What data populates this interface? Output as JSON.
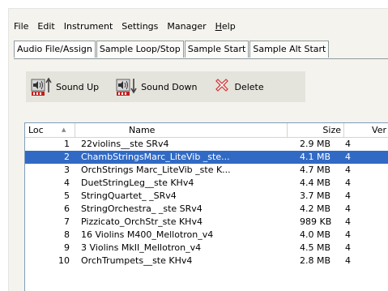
{
  "menubar": {
    "items": [
      {
        "label": "File"
      },
      {
        "label": "Edit"
      },
      {
        "label": "Instrument"
      },
      {
        "label": "Settings"
      },
      {
        "label": "Manager"
      },
      {
        "pre": "",
        "mnemonic": "H",
        "post": "elp"
      }
    ]
  },
  "tabs": [
    {
      "label": "Audio File/Assign",
      "active": true
    },
    {
      "label": "Sample Loop/Stop"
    },
    {
      "label": "Sample Start"
    },
    {
      "label": "Sample Alt Start"
    }
  ],
  "toolbar": {
    "sound_up": "Sound Up",
    "sound_down": "Sound Down",
    "delete": "Delete"
  },
  "list": {
    "columns": {
      "loc": "Loc",
      "name": "Name",
      "size": "Size",
      "ver": "Ver"
    },
    "rows": [
      {
        "loc": "1",
        "name": "22violins__ste SRv4",
        "size": "2.9 MB",
        "ver": "4"
      },
      {
        "loc": "2",
        "name": "ChambStringsMarc_LiteVib _ste...",
        "size": "4.1 MB",
        "ver": "4",
        "selected": true
      },
      {
        "loc": "3",
        "name": "OrchStrings Marc_LiteVib _ste K...",
        "size": "4.7 MB",
        "ver": "4"
      },
      {
        "loc": "4",
        "name": "DuetStringLeg__ste KHv4",
        "size": "4.4 MB",
        "ver": "4"
      },
      {
        "loc": "5",
        "name": "StringQuartet_ _SRv4",
        "size": "3.7 MB",
        "ver": "4"
      },
      {
        "loc": "6",
        "name": "StringOrchestra_ _ste SRv4",
        "size": "4.2 MB",
        "ver": "4"
      },
      {
        "loc": "7",
        "name": "Pizzicato_OrchStr_ste KHv4",
        "size": "989 KB",
        "ver": "4"
      },
      {
        "loc": "8",
        "name": "16 Violins M400_Mellotron_v4",
        "size": "4.0 MB",
        "ver": "4"
      },
      {
        "loc": "9",
        "name": "3 Violins MkII_Mellotron_v4",
        "size": "4.5 MB",
        "ver": "4"
      },
      {
        "loc": "10",
        "name": "OrchTrumpets__ste KHv4",
        "size": "2.8 MB",
        "ver": "4"
      }
    ]
  },
  "colors": {
    "selection": "#316ac5",
    "toolbar_bg": "#e5e4dc",
    "delete_icon": "#d23c3c"
  },
  "icons": {
    "sound_up": "speaker-up-arrow-icon",
    "sound_down": "speaker-down-arrow-icon",
    "delete": "delete-x-icon",
    "sort": "sort-ascending-icon"
  }
}
